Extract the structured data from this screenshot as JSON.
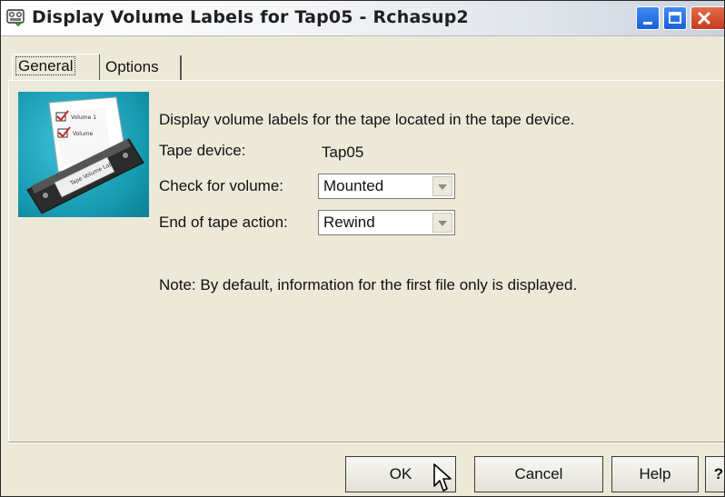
{
  "window": {
    "title": "Display Volume Labels for Tap05 - Rchasup2",
    "controls": {
      "minimize": "minimize-icon",
      "maximize": "maximize-icon",
      "close": "close-icon"
    }
  },
  "tabs": [
    {
      "label": "General",
      "selected": true
    },
    {
      "label": "Options",
      "selected": false
    }
  ],
  "general": {
    "description": "Display volume labels for the tape located in the tape device.",
    "tape_device_label": "Tape device:",
    "tape_device_value": "Tap05",
    "check_label": "Check for volume:",
    "check_value": "Mounted",
    "end_label": "End of tape action:",
    "end_value": "Rewind",
    "note": "Note:  By default, information for the first file only is displayed."
  },
  "image": {
    "tape_label": "Tape Volume Label",
    "list_items": [
      "Volume 1",
      "Volume"
    ]
  },
  "buttons": {
    "ok": "OK",
    "cancel": "Cancel",
    "help": "Help",
    "question": "?"
  },
  "colors": {
    "dialog_bg": "#ece9d8",
    "image_bg": "#1597ad",
    "close_button": "#c63b1f",
    "title_buttons": "#1b5fd6"
  }
}
